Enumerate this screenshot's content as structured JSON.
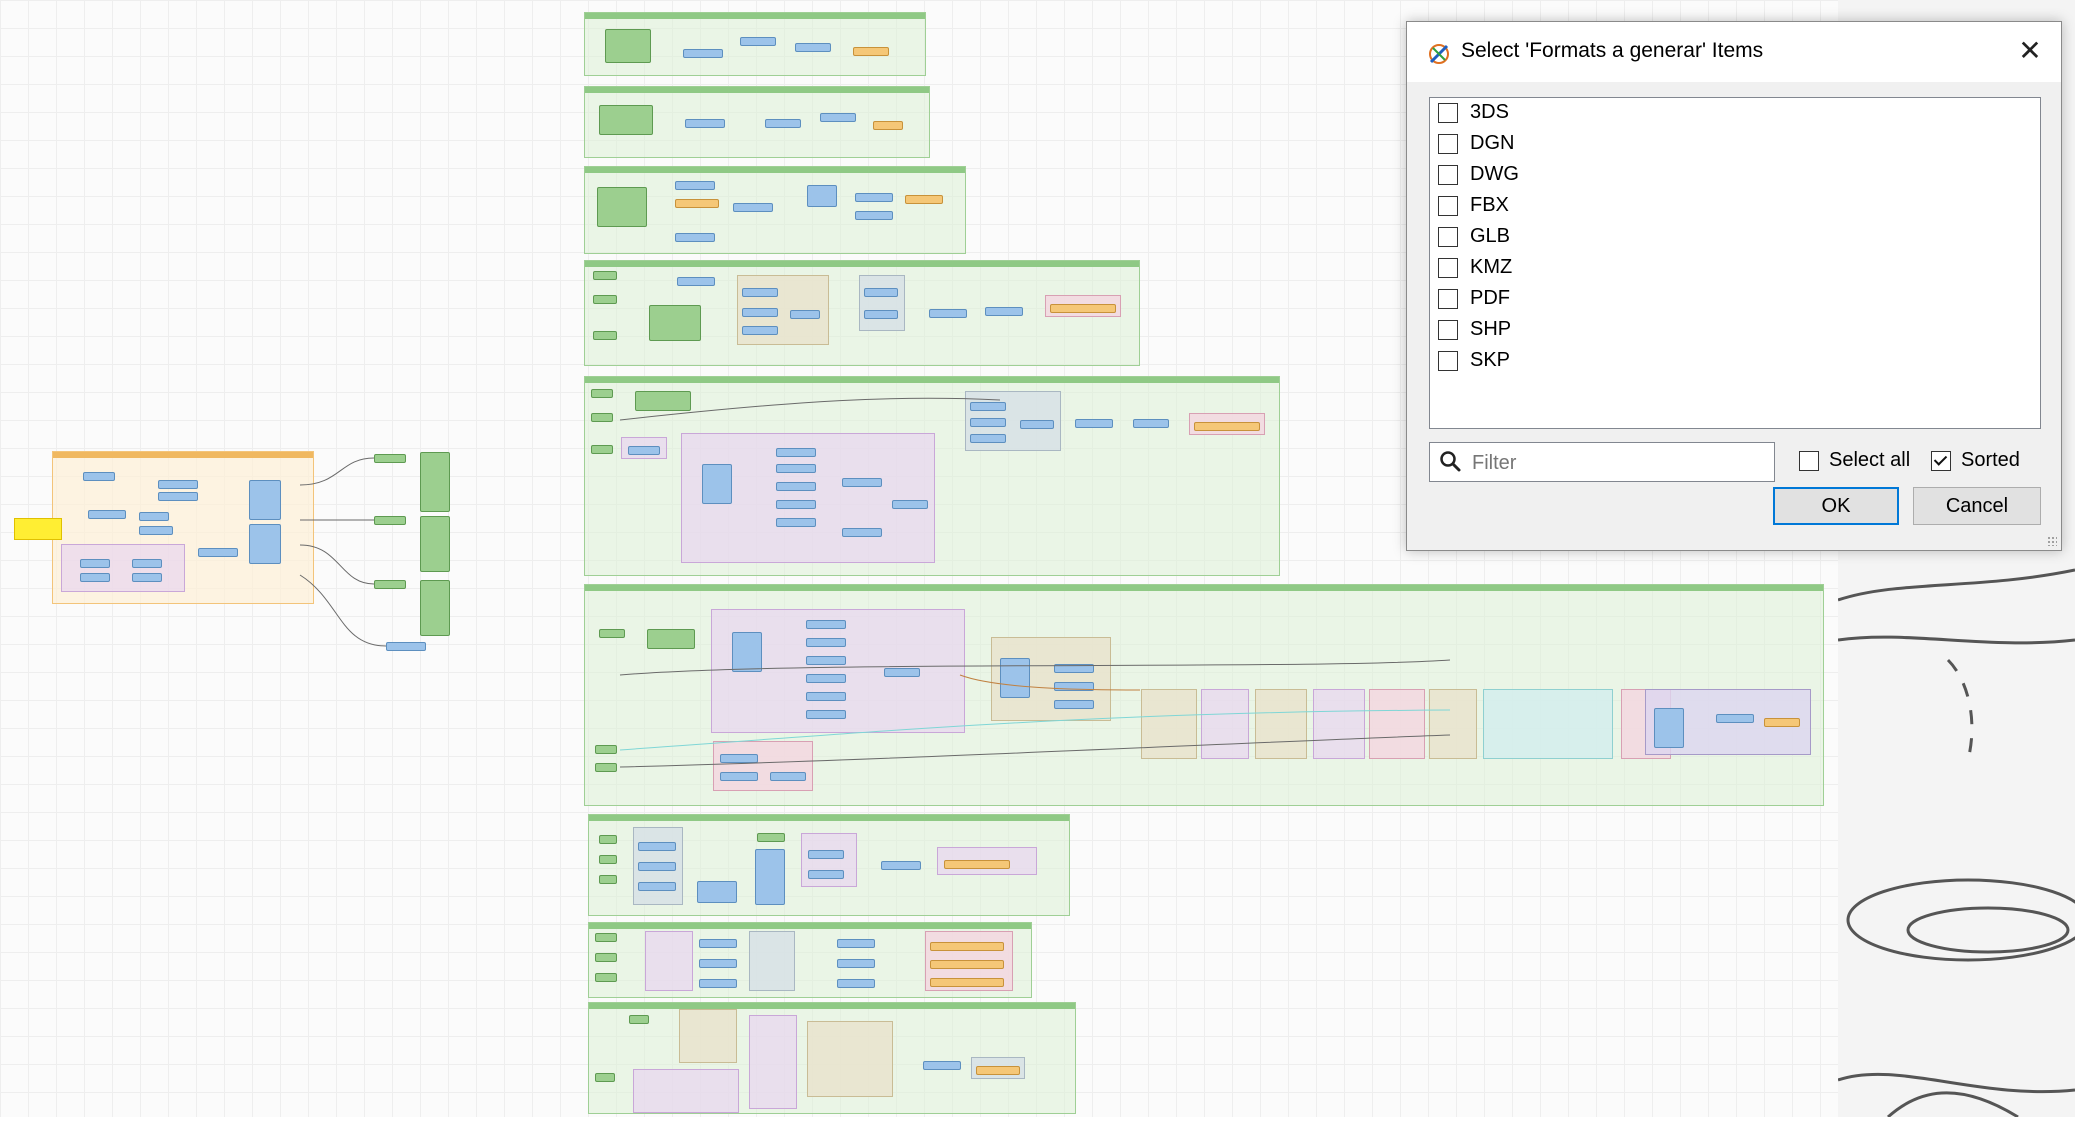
{
  "dialog": {
    "title": "Select 'Formats a generar' Items",
    "close_glyph": "✕",
    "items": [
      {
        "label": "3DS",
        "checked": false
      },
      {
        "label": "DGN",
        "checked": false
      },
      {
        "label": "DWG",
        "checked": false
      },
      {
        "label": "FBX",
        "checked": false
      },
      {
        "label": "GLB",
        "checked": false
      },
      {
        "label": "KMZ",
        "checked": false
      },
      {
        "label": "PDF",
        "checked": false
      },
      {
        "label": "SHP",
        "checked": false
      },
      {
        "label": "SKP",
        "checked": false
      }
    ],
    "filter_placeholder": "Filter",
    "select_all_label": "Select all",
    "select_all_checked": false,
    "sorted_label": "Sorted",
    "sorted_checked": true,
    "ok_label": "OK",
    "cancel_label": "Cancel",
    "icons": {
      "app": "workbench-app-icon",
      "close": "close-icon",
      "filter": "search-icon"
    },
    "colors": {
      "default_button_border": "#0078d7",
      "title_bar": "#ffffff",
      "body": "#f0f0f0"
    }
  },
  "canvas": {
    "description_colors": {
      "bookmark": "#dcf0d6",
      "transformer": "#9cc3ea",
      "reader_writer": "#9ccf8f",
      "writer_orange": "#f5c777",
      "annotation_yellow": "#ffee33"
    }
  }
}
